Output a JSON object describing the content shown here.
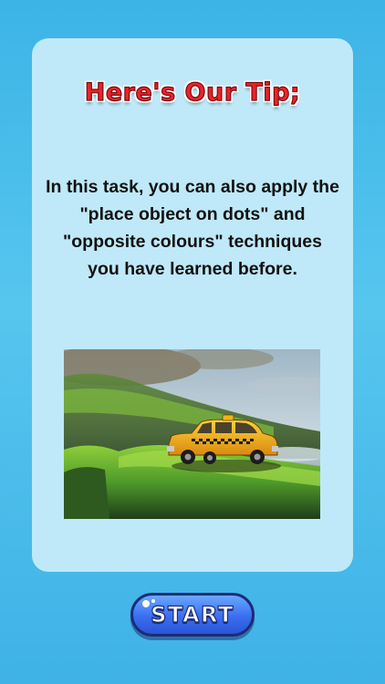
{
  "card": {
    "title": "Here's Our Tip;",
    "tip_text": "In this task, you can also apply the \"place object on dots\" and \"opposite colours\" techniques you have learned before."
  },
  "photo": {
    "subject": "toy-taxi-on-mossy-rock"
  },
  "start_button": {
    "label": "START"
  },
  "colors": {
    "background": "#3cb4e6",
    "card": "#bfe9f8",
    "title_red": "#e8242a",
    "button_blue": "#3a6ef0"
  }
}
